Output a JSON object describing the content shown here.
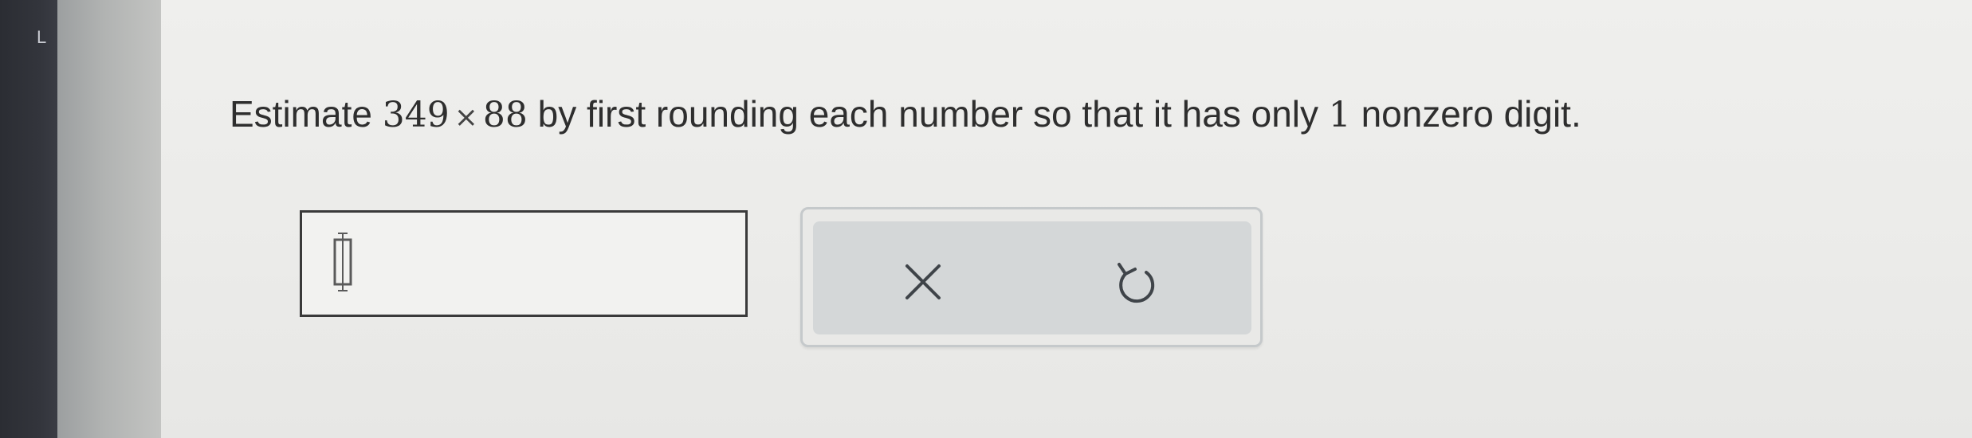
{
  "question": {
    "prefix": "Estimate",
    "num_a": "349",
    "times_symbol": "×",
    "num_b": "88",
    "middle": "by first rounding each number so that it has only",
    "count": "1",
    "suffix": "nonzero digit."
  },
  "answer": {
    "value": "",
    "icon": "text-cursor-icon"
  },
  "tools": {
    "clear_icon": "close-icon",
    "undo_icon": "undo-icon"
  },
  "bezel": {
    "mark": "L"
  }
}
